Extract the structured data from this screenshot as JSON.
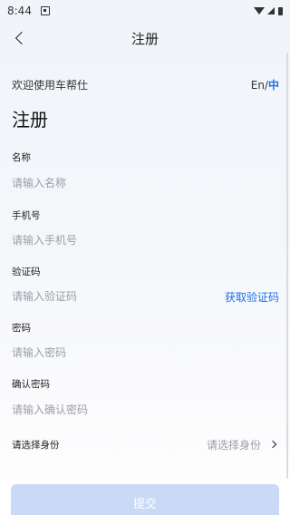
{
  "status_bar": {
    "time": "8:44"
  },
  "nav": {
    "title": "注册"
  },
  "welcome": {
    "text": "欢迎使用车帮仕",
    "lang_en": "En",
    "lang_sep": "/",
    "lang_zh": "中"
  },
  "page_title": "注册",
  "form": {
    "name": {
      "label": "名称",
      "placeholder": "请输入名称",
      "value": ""
    },
    "phone": {
      "label": "手机号",
      "placeholder": "请输入手机号",
      "value": ""
    },
    "code": {
      "label": "验证码",
      "placeholder": "请输入验证码",
      "value": "",
      "action": "获取验证码"
    },
    "password": {
      "label": "密码",
      "placeholder": "请输入密码",
      "value": ""
    },
    "confirm_password": {
      "label": "确认密码",
      "placeholder": "请输入确认密码",
      "value": ""
    },
    "identity": {
      "label": "请选择身份",
      "value": "请选择身份"
    }
  },
  "submit_label": "提交",
  "colors": {
    "accent": "#1a73e8",
    "submit_bg": "#c9d9f6",
    "placeholder": "#9a9ea6"
  },
  "icons": [
    "a-notification-icon",
    "wifi-icon",
    "signal-icon",
    "battery-icon",
    "back-arrow-icon",
    "chevron-right-icon"
  ]
}
